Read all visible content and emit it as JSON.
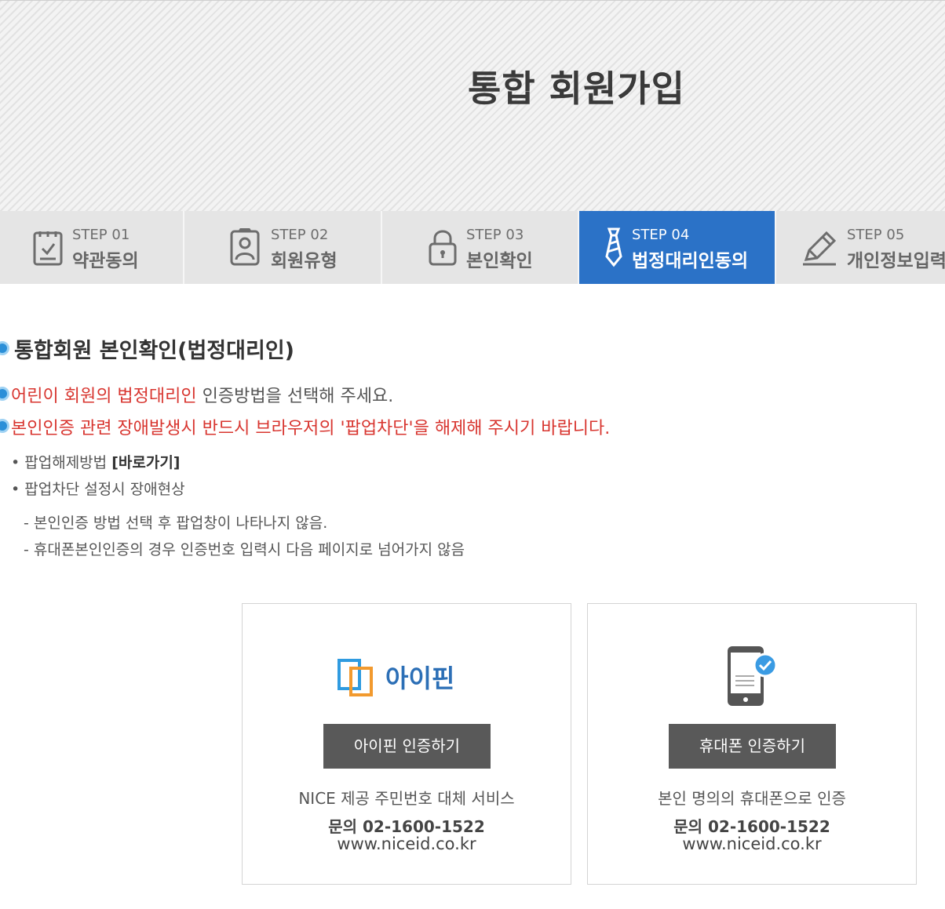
{
  "header": {
    "title": "통합 회원가입"
  },
  "steps": [
    {
      "num": "STEP 01",
      "label": "약관동의",
      "icon": "checklist-icon",
      "active": false
    },
    {
      "num": "STEP 02",
      "label": "회원유형",
      "icon": "member-icon",
      "active": false
    },
    {
      "num": "STEP 03",
      "label": "본인확인",
      "icon": "lock-icon",
      "active": false
    },
    {
      "num": "STEP 04",
      "label": "법정대리인동의",
      "icon": "tie-icon",
      "active": true
    },
    {
      "num": "STEP 05",
      "label": "개인정보입력",
      "icon": "pencil-icon",
      "active": false
    }
  ],
  "section": {
    "title": "통합회원 본인확인(법정대리인)"
  },
  "notices": {
    "line1_red": "어린이 회원의 법정대리인",
    "line1_rest": " 인증방법을 선택해 주세요.",
    "line2": "본인인증 관련 장애발생시 반드시 브라우저의 '팝업차단'을 해제해 주시기 바랍니다."
  },
  "popup": {
    "release_label": "팝업해제방법",
    "release_link": "[바로가기]",
    "issue_label": "팝업차단 설정시 장애현상",
    "issues": [
      "- 본인인증 방법 선택 후 팝업창이 나타나지 않음.",
      "- 휴대폰본인인증의 경우 인증번호 입력시 다음 페이지로 넘어가지 않음"
    ]
  },
  "cards": {
    "ipin": {
      "logo_text": "아이핀",
      "button": "아이핀 인증하기",
      "desc": "NICE 제공 주민번호 대체 서비스",
      "phone": "문의 02-1600-1522",
      "url": "www.niceid.co.kr"
    },
    "mobile": {
      "button": "휴대폰 인증하기",
      "desc": "본인 명의의 휴대폰으로 인증",
      "phone": "문의 02-1600-1522",
      "url": "www.niceid.co.kr"
    }
  },
  "colors": {
    "active_step": "#2b72c7",
    "notice_red": "#d8352f",
    "button_gray": "#595959",
    "bullet_blue": "#2b8fd8"
  }
}
